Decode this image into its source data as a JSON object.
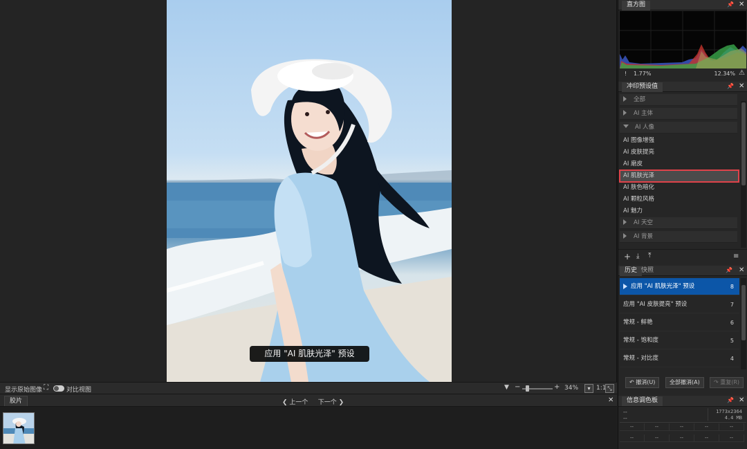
{
  "viewer": {
    "toast": "应用 \"AI 肌肤光泽\" 预设",
    "bottom_bar": {
      "show_original": "显示原始图像",
      "compare_view": "对比视图",
      "zoom": "34%",
      "ratio": "1:1"
    }
  },
  "filmstrip": {
    "tab": "胶片",
    "prev": "上一个",
    "next": "下一个"
  },
  "histogram": {
    "title": "直方图",
    "left_clip": "1.77%",
    "right_clip": "12.34%"
  },
  "presets": {
    "title": "冲印预设值",
    "items": [
      {
        "label": "全部",
        "type": "group",
        "open": false
      },
      {
        "label": "AI 主体",
        "type": "group",
        "open": false
      },
      {
        "label": "AI 人像",
        "type": "group",
        "open": true
      },
      {
        "label": "AI 图像增强",
        "type": "item"
      },
      {
        "label": "AI 皮肤提亮",
        "type": "item"
      },
      {
        "label": "AI 磨皮",
        "type": "item"
      },
      {
        "label": "AI 肌肤光泽",
        "type": "item",
        "selected": true
      },
      {
        "label": "AI 肤色暗化",
        "type": "item"
      },
      {
        "label": "AI 颗粒风格",
        "type": "item"
      },
      {
        "label": "AI 魅力",
        "type": "item"
      },
      {
        "label": "AI 天空",
        "type": "group",
        "open": false
      },
      {
        "label": "AI 背景",
        "type": "group",
        "open": false
      }
    ]
  },
  "history": {
    "tabs": [
      "历史",
      "快照"
    ],
    "items": [
      {
        "label": "应用 \"AI 肌肤光泽\" 预设",
        "num": "8",
        "active": true
      },
      {
        "label": "应用 \"AI 皮肤提亮\" 预设",
        "num": "7"
      },
      {
        "label": "常规 - 鲜艳",
        "num": "6"
      },
      {
        "label": "常规 - 饱和度",
        "num": "5"
      },
      {
        "label": "常规 - 对比度",
        "num": "4"
      }
    ],
    "undo": "撤消(U)",
    "undo_all": "全部撤消(A)",
    "redo": "重复(R)"
  },
  "info": {
    "title": "信息调色板",
    "dims": "1773x2364",
    "size": "4.4 MB",
    "dash": "--"
  },
  "colors": {
    "selected_outline": "#e0424a",
    "history_active": "#0c56a8"
  }
}
